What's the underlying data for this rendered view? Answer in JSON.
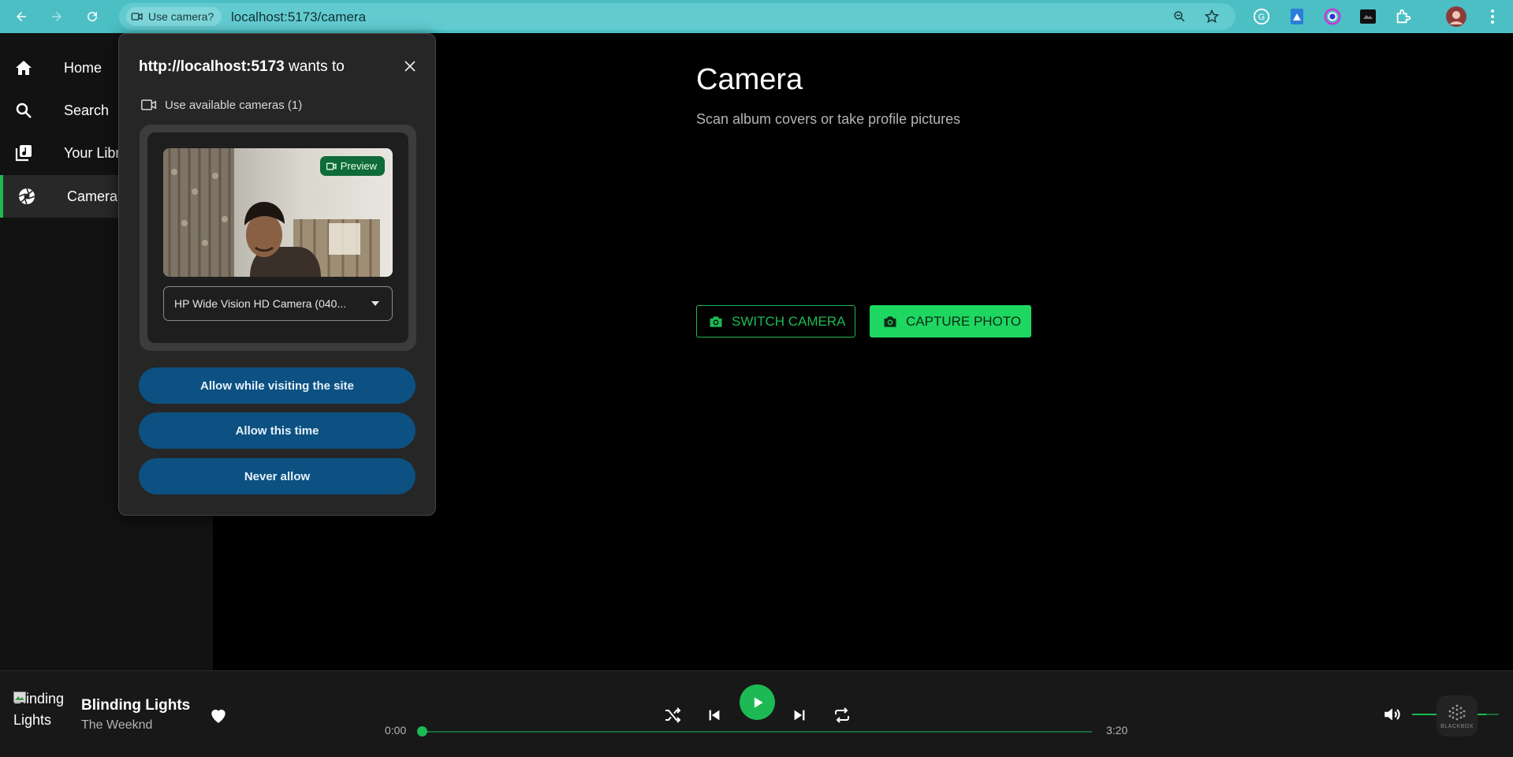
{
  "browser": {
    "url": "localhost:5173/camera",
    "chip_label": "Use camera?",
    "toolbar_color": "#4bbfc4"
  },
  "sidebar": {
    "items": [
      {
        "label": "Home",
        "icon": "home-icon"
      },
      {
        "label": "Search",
        "icon": "search-icon"
      },
      {
        "label": "Your Library",
        "icon": "library-icon"
      },
      {
        "label": "Camera",
        "icon": "camera-aperture-icon",
        "active": true
      }
    ]
  },
  "main": {
    "title": "Camera",
    "subtitle": "Scan album covers or take profile pictures",
    "switch_camera_label": "SWITCH CAMERA",
    "capture_photo_label": "CAPTURE PHOTO",
    "accent": "#1db954"
  },
  "popup": {
    "origin": "http://localhost:5173",
    "wants_to": "wants to",
    "permission_text": "Use available cameras (1)",
    "preview_label": "Preview",
    "camera_select_value": "HP Wide Vision HD Camera (040...",
    "allow_visiting_label": "Allow while visiting the site",
    "allow_once_label": "Allow this time",
    "never_allow_label": "Never allow",
    "button_color": "#0c5181"
  },
  "player": {
    "art_alt": "Blinding Lights",
    "track_title": "Blinding Lights",
    "artist": "The Weeknd",
    "elapsed": "0:00",
    "duration": "3:20",
    "progress_fraction": 0.0,
    "volume_fraction": 0.85
  }
}
